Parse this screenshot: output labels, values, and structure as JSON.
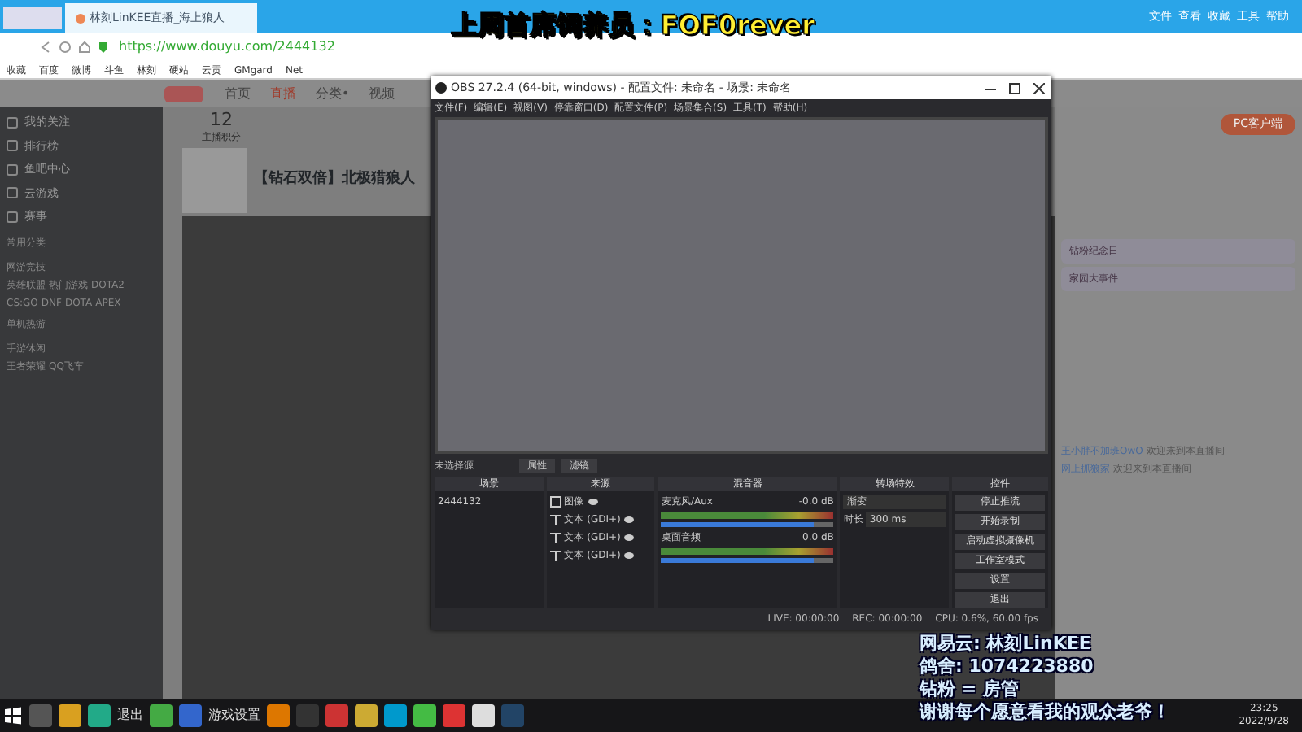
{
  "browser": {
    "tab_title": "林刻LinKEE直播_海上狼人",
    "url": "https://www.douyu.com/2444132",
    "menu": [
      "文件",
      "查看",
      "收藏",
      "工具",
      "帮助"
    ],
    "bookmarks": [
      "收藏",
      "百度",
      "微博",
      "斗鱼",
      "林刻",
      "硬站",
      "云贡",
      "GMgard",
      "Net"
    ]
  },
  "site": {
    "nav": [
      {
        "label": "首页",
        "selected": false
      },
      {
        "label": "直播",
        "selected": true
      },
      {
        "label": "分类•",
        "selected": false
      },
      {
        "label": "视频",
        "selected": false
      }
    ],
    "sidebar": {
      "items": [
        "我的关注",
        "排行榜",
        "鱼吧中心",
        "云游戏",
        "赛事"
      ],
      "sections": [
        {
          "title": "常用分类"
        },
        {
          "title": "网游竞技",
          "games": [
            "英雄联盟",
            "热门游戏",
            "DOTA2",
            "CS:GO",
            "DNF",
            "DOTA",
            "APEX"
          ]
        },
        {
          "title": "单机热游"
        },
        {
          "title": "手游休闲",
          "games": [
            "王者荣耀",
            "QQ飞车"
          ]
        }
      ]
    },
    "stats": [
      {
        "value": "12",
        "label": "主播积分"
      }
    ],
    "streamer_title": "【钻石双倍】北极猎狼人",
    "right_panel": {
      "client_button": "PC客户端",
      "notices": [
        "钻粉纪念日",
        "家园大事件"
      ],
      "chat": [
        {
          "user": "王小胖不加班OwO",
          "text": "欢迎来到本直播间"
        },
        {
          "user": "网上抓狼家",
          "text": "欢迎来到本直播间"
        }
      ]
    }
  },
  "obs": {
    "title": "OBS 27.2.4 (64-bit, windows) - 配置文件: 未命名 - 场景: 未命名",
    "menu": [
      "文件(F)",
      "编辑(E)",
      "视图(V)",
      "停靠窗口(D)",
      "配置文件(P)",
      "场景集合(S)",
      "工具(T)",
      "帮助(H)"
    ],
    "no_source": "未选择源",
    "props_button": "属性",
    "filters_button": "滤镜",
    "docks": [
      "场景",
      "来源",
      "混音器",
      "转场特效",
      "控件"
    ],
    "scenes": [
      "2444132"
    ],
    "sources": [
      {
        "kind": "image",
        "label": "图像"
      },
      {
        "kind": "text",
        "label": "文本 (GDI+)"
      },
      {
        "kind": "text",
        "label": "文本 (GDI+)"
      },
      {
        "kind": "text",
        "label": "文本 (GDI+)"
      }
    ],
    "mixer": [
      {
        "name": "麦克风/Aux",
        "reading": "-0.0 dB",
        "level": 0.88
      },
      {
        "name": "桌面音频",
        "reading": "0.0 dB",
        "level": 0.88
      }
    ],
    "transition": {
      "name": "渐变",
      "duration_label": "时长",
      "duration": "300 ms"
    },
    "controls": [
      "停止推流",
      "开始录制",
      "启动虚拟摄像机",
      "工作室模式",
      "设置",
      "退出"
    ],
    "status": [
      "LIVE: 00:00:00",
      "REC: 00:00:00",
      "CPU: 0.6%, 60.00 fps"
    ]
  },
  "overlay": {
    "top": "上周首席饲养员：FOF0rever",
    "lines": [
      "网易云: 林刻LinKEE",
      "鸽舍: 1074223880",
      "钻粉 = 房管",
      "谢谢每个愿意看我的观众老爷！"
    ]
  },
  "taskbar": {
    "labels": [
      "退出",
      "游戏设置"
    ],
    "time": "23:25",
    "date": "2022/9/28"
  }
}
